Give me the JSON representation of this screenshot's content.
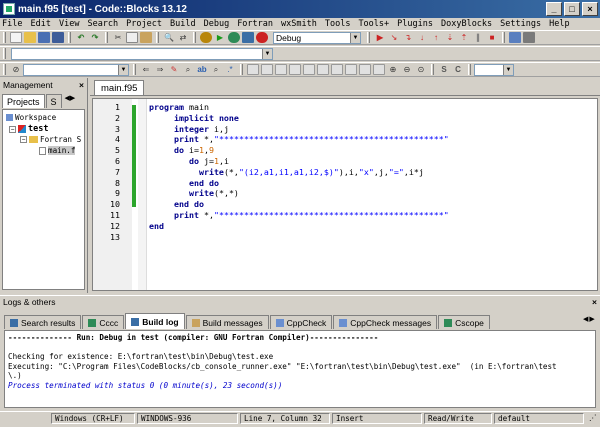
{
  "window": {
    "title": "main.f95 [test] - Code::Blocks 13.12",
    "controls": [
      "_",
      "□",
      "×"
    ]
  },
  "menu": [
    "File",
    "Edit",
    "View",
    "Search",
    "Project",
    "Build",
    "Debug",
    "Fortran",
    "wxSmith",
    "Tools",
    "Tools+",
    "Plugins",
    "DoxyBlocks",
    "Settings",
    "Help"
  ],
  "toolbar": {
    "build_target": "Debug"
  },
  "management": {
    "title": "Management",
    "tabs": [
      "Projects",
      "S"
    ],
    "tree": [
      {
        "label": "Workspace",
        "level": 0
      },
      {
        "label": "test",
        "level": 1,
        "bold": true
      },
      {
        "label": "Fortran S",
        "level": 2
      },
      {
        "label": "main.f",
        "level": 3
      }
    ]
  },
  "editor": {
    "tab": "main.f95",
    "lines": [
      {
        "n": "1",
        "html": "<span class=\"kw\">program</span> main"
      },
      {
        "n": "2",
        "html": "     <span class=\"kw\">implicit none</span>"
      },
      {
        "n": "3",
        "html": "     <span class=\"kw\">integer</span> i,j"
      },
      {
        "n": "4",
        "html": "     <span class=\"kw\">print</span> *,<span class=\"str\">\"*********************************************\"</span>"
      },
      {
        "n": "5",
        "html": "     <span class=\"kw\">do</span> i=<span class=\"num\">1</span>,<span class=\"num\">9</span>"
      },
      {
        "n": "6",
        "html": "        <span class=\"kw\">do</span> j=<span class=\"num\">1</span>,i"
      },
      {
        "n": "7",
        "html": "          <span class=\"kw\">write</span>(*,<span class=\"str\">\"(i2,a1,i1,a1,i2,$)\"</span>),i,<span class=\"str\">\"x\"</span>,j,<span class=\"str\">\"=\"</span>,i*j"
      },
      {
        "n": "8",
        "html": "        <span class=\"kw\">end do</span>"
      },
      {
        "n": "9",
        "html": "        <span class=\"kw\">write</span>(*,*)"
      },
      {
        "n": "10",
        "html": "     <span class=\"kw\">end do</span>"
      },
      {
        "n": "11",
        "html": "     <span class=\"kw\">print</span> *,<span class=\"str\">\"*********************************************\"</span>"
      },
      {
        "n": "12",
        "html": "<span class=\"kw\">end</span>"
      },
      {
        "n": "13",
        "html": ""
      }
    ]
  },
  "logs": {
    "title": "Logs & others",
    "tabs": [
      "Search results",
      "Cccc",
      "Build log",
      "Build messages",
      "CppCheck",
      "CppCheck messages",
      "Cscope"
    ],
    "active_tab": "Build log",
    "lines": [
      {
        "text": "-------------- Run: Debug in test (compiler: GNU Fortran Compiler)---------------",
        "color": "#000000",
        "bold": true,
        "italic": false
      },
      {
        "text": "",
        "color": "#000000",
        "bold": false,
        "italic": false
      },
      {
        "text": "Checking for existence: E:\\fortran\\test\\bin\\Debug\\test.exe",
        "color": "#000000",
        "bold": false,
        "italic": false
      },
      {
        "text": "Executing: \"C:\\Program Files\\CodeBlocks/cb_console_runner.exe\" \"E:\\fortran\\test\\bin\\Debug\\test.exe\"  (in E:\\fortran\\test",
        "color": "#000000",
        "bold": false,
        "italic": false
      },
      {
        "text": "\\.)",
        "color": "#000000",
        "bold": false,
        "italic": false
      },
      {
        "text": "Process terminated with status 0 (0 minute(s), 23 second(s))",
        "color": "#0000cc",
        "bold": false,
        "italic": true
      }
    ]
  },
  "statusbar": {
    "eol": "Windows (CR+LF)",
    "encoding": "WINDOWS-936",
    "position": "Line 7, Column 32",
    "mode": "Insert",
    "access": "Read/Write",
    "profile": "default"
  }
}
